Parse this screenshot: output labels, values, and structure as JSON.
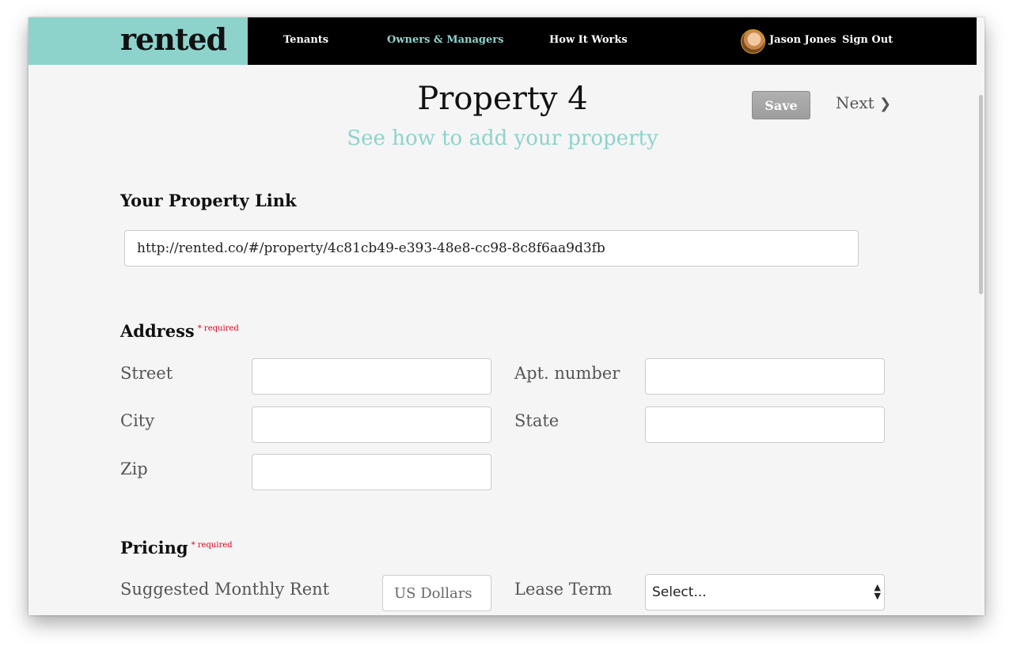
{
  "brand": {
    "logo": "rented",
    "accent_color": "#8dd3cc"
  },
  "nav": {
    "links": [
      {
        "label": "Tenants"
      },
      {
        "label": "Owners & Managers",
        "active": true
      },
      {
        "label": "How It Works"
      }
    ],
    "user_name": "Jason Jones",
    "sign_out": "Sign Out"
  },
  "page": {
    "title": "Property 4",
    "subtitle": "See how to add your property",
    "save_label": "Save",
    "next_label": "Next",
    "next_icon": "❯"
  },
  "property_link": {
    "heading": "Your Property Link",
    "url": "http://rented.co/#/property/4c81cb49-e393-48e8-cc98-8c8f6aa9d3fb"
  },
  "address": {
    "heading": "Address",
    "required_note": "* required",
    "street_label": "Street",
    "apt_label": "Apt. number",
    "city_label": "City",
    "state_label": "State",
    "zip_label": "Zip",
    "street_value": "",
    "apt_value": "",
    "city_value": "",
    "state_value": "",
    "zip_value": ""
  },
  "pricing": {
    "heading": "Pricing",
    "required_note": "* required",
    "rent_label": "Suggested Monthly Rent",
    "rent_placeholder": "US Dollars",
    "lease_label": "Lease Term",
    "lease_selected": "Select..."
  }
}
